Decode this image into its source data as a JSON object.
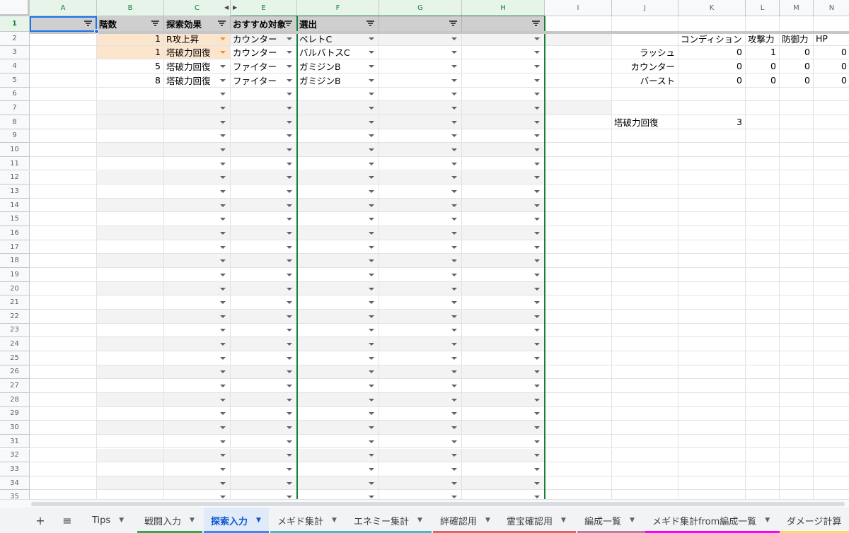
{
  "columns": [
    {
      "letter": "A",
      "w": 95
    },
    {
      "letter": "B",
      "w": 95
    },
    {
      "letter": "C",
      "w": 94
    },
    {
      "letter": "E",
      "w": 94
    },
    {
      "letter": "F",
      "w": 116
    },
    {
      "letter": "G",
      "w": 117
    },
    {
      "letter": "H",
      "w": 117
    },
    {
      "letter": "I",
      "w": 95
    },
    {
      "letter": "J",
      "w": 94
    },
    {
      "letter": "K",
      "w": 95
    },
    {
      "letter": "L",
      "w": 48
    },
    {
      "letter": "M",
      "w": 48
    },
    {
      "letter": "N",
      "w": 52
    }
  ],
  "rows": [
    "1",
    "2",
    "3",
    "4",
    "5",
    "6",
    "7",
    "8",
    "9",
    "10",
    "11",
    "12",
    "13",
    "14",
    "15",
    "16",
    "17",
    "18",
    "19",
    "20",
    "21",
    "22",
    "23",
    "24",
    "25",
    "26",
    "27",
    "28",
    "29",
    "30",
    "31",
    "32",
    "33",
    "34",
    "35"
  ],
  "header_row": {
    "B": "階数",
    "C": "探索効果",
    "E": "おすすめ対象",
    "F": "選出",
    "G": "",
    "H": ""
  },
  "data_rows": [
    {
      "B": "1",
      "C": "R攻上昇",
      "E": "カウンター",
      "F": "ベレトC"
    },
    {
      "B": "1",
      "C": "塔破力回復",
      "E": "カウンター",
      "F": "バルバトスC"
    },
    {
      "B": "5",
      "C": "塔破力回復",
      "E": "ファイター",
      "F": "ガミジンB"
    },
    {
      "B": "8",
      "C": "塔破力回復",
      "E": "ファイター",
      "F": "ガミジンB"
    }
  ],
  "side_table": {
    "headers": [
      "コンディション",
      "攻撃力",
      "防御力",
      "HP"
    ],
    "rows": [
      {
        "label": "ラッシュ",
        "values": [
          "0",
          "1",
          "0",
          "0"
        ]
      },
      {
        "label": "カウンター",
        "values": [
          "0",
          "0",
          "0",
          "0"
        ]
      },
      {
        "label": "バースト",
        "values": [
          "0",
          "0",
          "0",
          "0"
        ]
      }
    ],
    "extra_label": "塔破力回復",
    "extra_value": "3"
  },
  "toolbar": {
    "add_sheet": "+",
    "all_sheets": "≡"
  },
  "sheet_tabs": [
    {
      "label": "Tips",
      "color": ""
    },
    {
      "label": "戦闘入力",
      "color": "#34a853"
    },
    {
      "label": "探索入力",
      "color": "#4285f4",
      "active": true
    },
    {
      "label": "メギド集計",
      "color": "#46bdc6"
    },
    {
      "label": "エネミー集計",
      "color": "#46bdc6"
    },
    {
      "label": "絆確認用",
      "color": "#e06666"
    },
    {
      "label": "霊宝確認用",
      "color": "#e06666"
    },
    {
      "label": "編成一覧",
      "color": "#c27ba0"
    },
    {
      "label": "メギド集計from編成一覧",
      "color": "#ff00ff"
    },
    {
      "label": "ダメージ計算",
      "color": "#ffd966"
    }
  ],
  "colors": {
    "filter_green": "#188038",
    "header_gray": "#cfcfcf",
    "selected_orange": "#fce5cd",
    "band_gray": "#f3f3f3",
    "selection_blue": "#1a73e8"
  }
}
